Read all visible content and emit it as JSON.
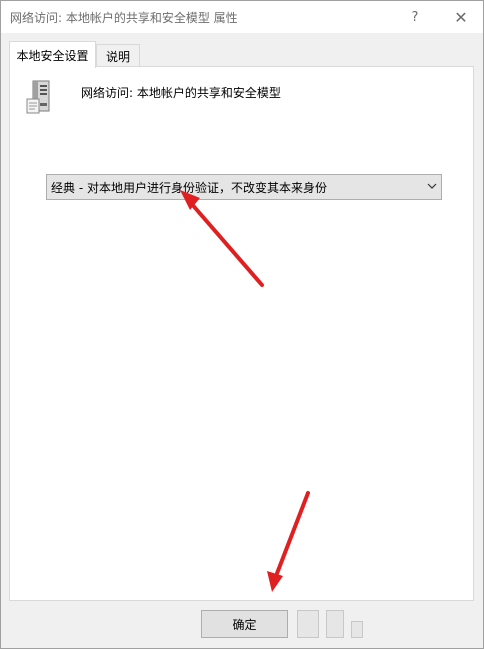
{
  "window": {
    "title": "网络访问: 本地帐户的共享和安全模型 属性",
    "help_label": "?",
    "close_label": "✕"
  },
  "tabs": [
    {
      "label": "本地安全设置",
      "active": true
    },
    {
      "label": "说明",
      "active": false
    }
  ],
  "panel": {
    "policy_name": "网络访问: 本地帐户的共享和安全模型",
    "policy_icon": "server-icon",
    "dropdown": {
      "selected_value": "经典 - 对本地用户进行身份验证，不改变其本来身份"
    }
  },
  "buttons": {
    "ok_label": "确定"
  },
  "annotations": {
    "arrow_color": "#e02020"
  }
}
